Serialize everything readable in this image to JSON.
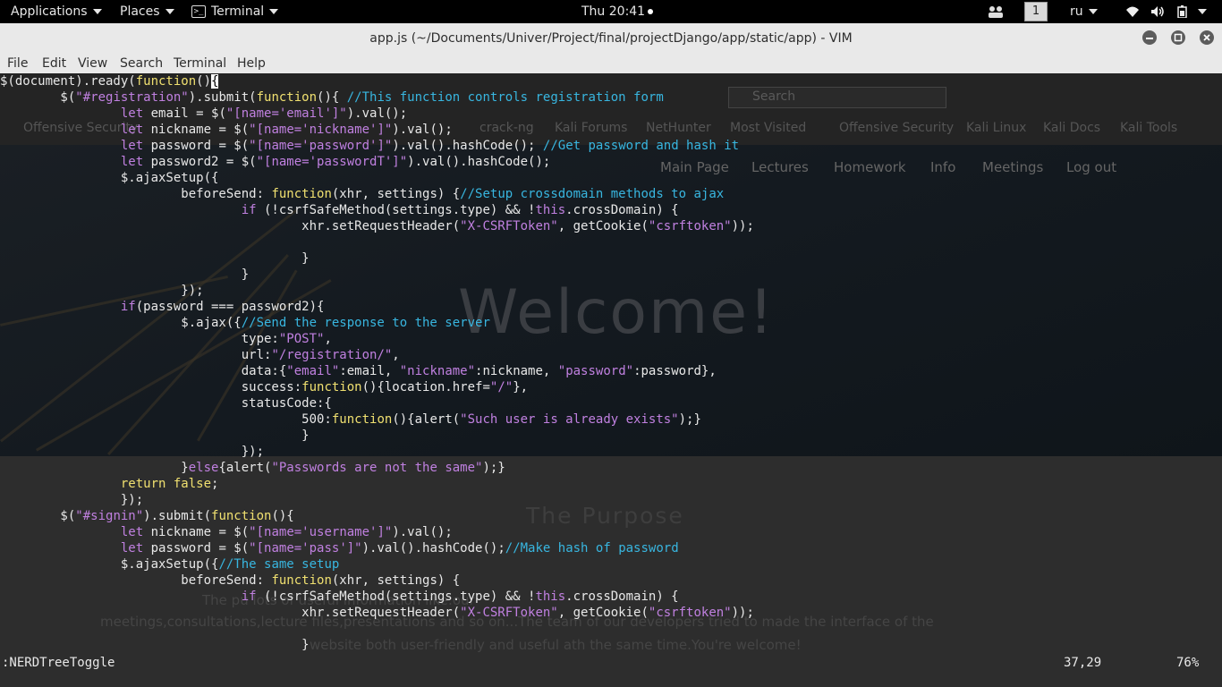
{
  "topbar": {
    "applications": "Applications",
    "places": "Places",
    "terminal": "Terminal",
    "clock": "Thu 20:41",
    "workspace": "1",
    "language": "ru"
  },
  "window": {
    "title": "app.js (~/Documents/Univer/Project/final/projectDjango/app/static/app) - VIM"
  },
  "menu": [
    "File",
    "Edit",
    "View",
    "Search",
    "Terminal",
    "Help"
  ],
  "background_page": {
    "search_placeholder": "Search",
    "bookmarks": [
      "Offensive Security",
      "crack-ng",
      "Kali Forums",
      "NetHunter",
      "Most Visited",
      "Offensive Security",
      "Kali Linux",
      "Kali Docs",
      "Kali Tools"
    ],
    "nav": [
      "Main Page",
      "Lectures",
      "Homework",
      "Info",
      "Meetings",
      "Log out"
    ],
    "welcome": "Welcome!",
    "purpose_title": "The Purpose",
    "purpose_lines": [
      "The pu                                                                        lots of useful information like:our",
      "meetings,consultations,lecture files,presentations and so on...The team of our developers tried to made the interface of the",
      "website both user-friendly and useful ath the same time.You're welcome!"
    ]
  },
  "code_lines": [
    "$(document).ready(function(){",
    "        $(\"#registration\").submit(function(){ //This function controls registration form",
    "                let email = $(\"[name='email']\").val();",
    "                let nickname = $(\"[name='nickname']\").val();",
    "                let password = $(\"[name='password']\").val().hashCode(); //Get password and hash it",
    "                let password2 = $(\"[name='passwordT']\").val().hashCode();",
    "                $.ajaxSetup({",
    "                        beforeSend: function(xhr, settings) {//Setup crossdomain methods to ajax",
    "                                if (!csrfSafeMethod(settings.type) && !this.crossDomain) {",
    "                                        xhr.setRequestHeader(\"X-CSRFToken\", getCookie(\"csrftoken\"));",
    "",
    "                                        }",
    "                                }",
    "                        });",
    "                if(password === password2){",
    "                        $.ajax({//Send the response to the server",
    "                                type:\"POST\",",
    "                                url:\"/registration/\",",
    "                                data:{\"email\":email, \"nickname\":nickname, \"password\":password},",
    "                                success:function(){location.href=\"/\"},",
    "                                statusCode:{",
    "                                        500:function(){alert(\"Such user is already exists\");}",
    "                                        }",
    "                                });",
    "                        }else{alert(\"Passwords are not the same\");}",
    "                return false;",
    "                });",
    "        $(\"#signin\").submit(function(){",
    "                let nickname = $(\"[name='username']\").val();",
    "                let password = $(\"[name='pass']\").val().hashCode();//Make hash of password",
    "                $.ajaxSetup({//The same setup",
    "                        beforeSend: function(xhr, settings) {",
    "                                if (!csrfSafeMethod(settings.type) && !this.crossDomain) {",
    "                                        xhr.setRequestHeader(\"X-CSRFToken\", getCookie(\"csrftoken\"));",
    "",
    "                                        }"
  ],
  "status": {
    "command": ":NERDTreeToggle",
    "position": "37,29",
    "percent": "76%"
  },
  "colors": {
    "keyword": "#f0e070",
    "string": "#c080e0",
    "comment": "#38b6e0",
    "text": "#e8e8e8"
  }
}
